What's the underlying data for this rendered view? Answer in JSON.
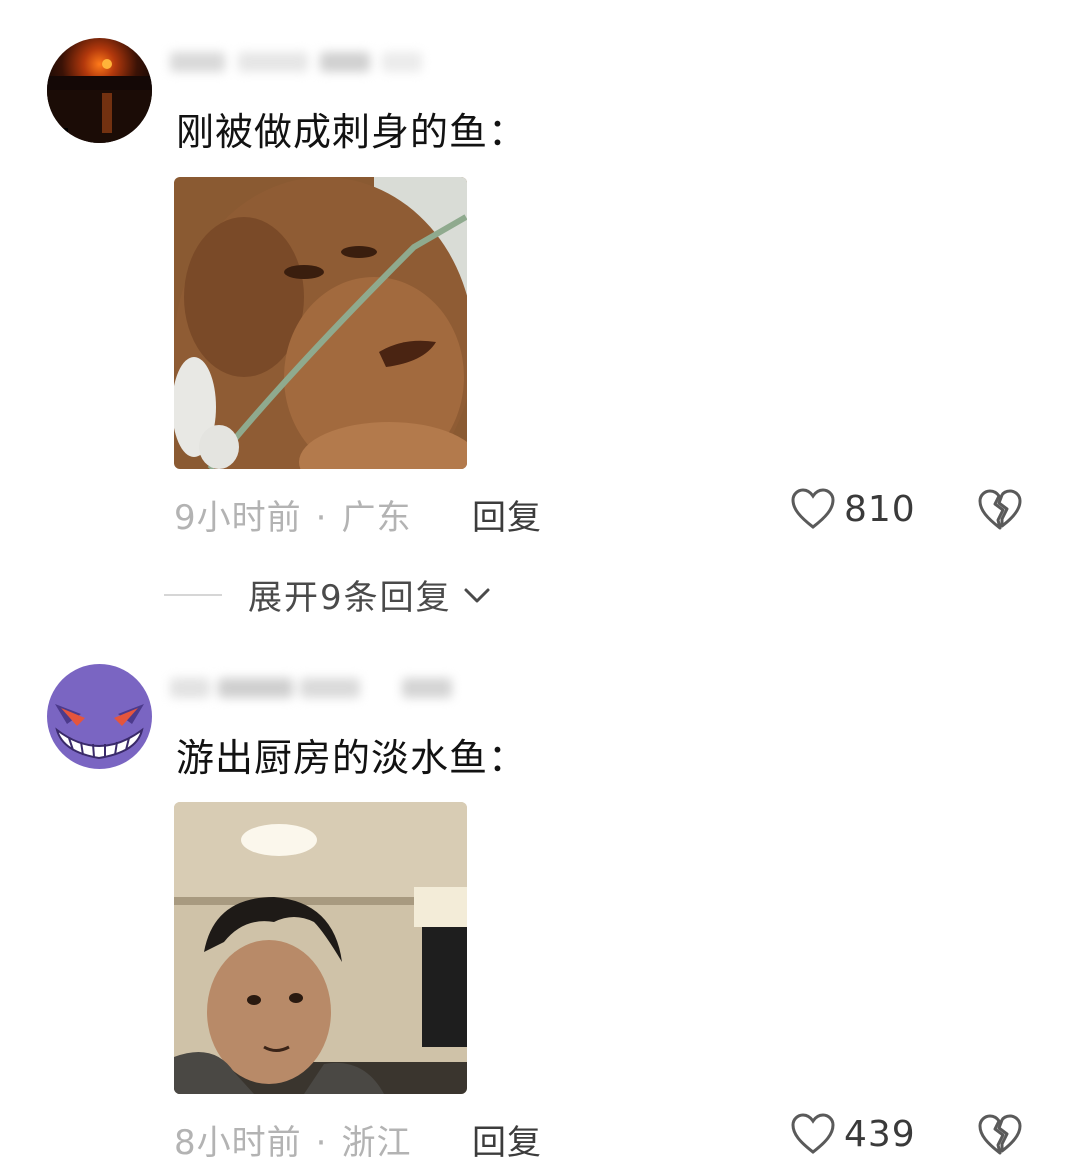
{
  "comments": [
    {
      "text": "刚被做成刺身的鱼：",
      "time": "9小时前",
      "location": "广东",
      "reply_label": "回复",
      "likes": "810",
      "avatar_icon": "sunset-lake-avatar",
      "image_icon": "orangutan-with-oxygen-tube-meme"
    },
    {
      "text": "游出厨房的淡水鱼：",
      "time": "8小时前",
      "location": "浙江",
      "reply_label": "回复",
      "likes": "439",
      "avatar_icon": "gengar-avatar",
      "image_icon": "startled-man-meme"
    }
  ],
  "expand_replies": {
    "label": "展开9条回复",
    "icon": "chevron-down-icon"
  },
  "separator": "·",
  "colors": {
    "meta_gray": "#b3b3b3",
    "reply_dark": "#3c3c3c",
    "icon_gray": "#5a5a5a"
  }
}
